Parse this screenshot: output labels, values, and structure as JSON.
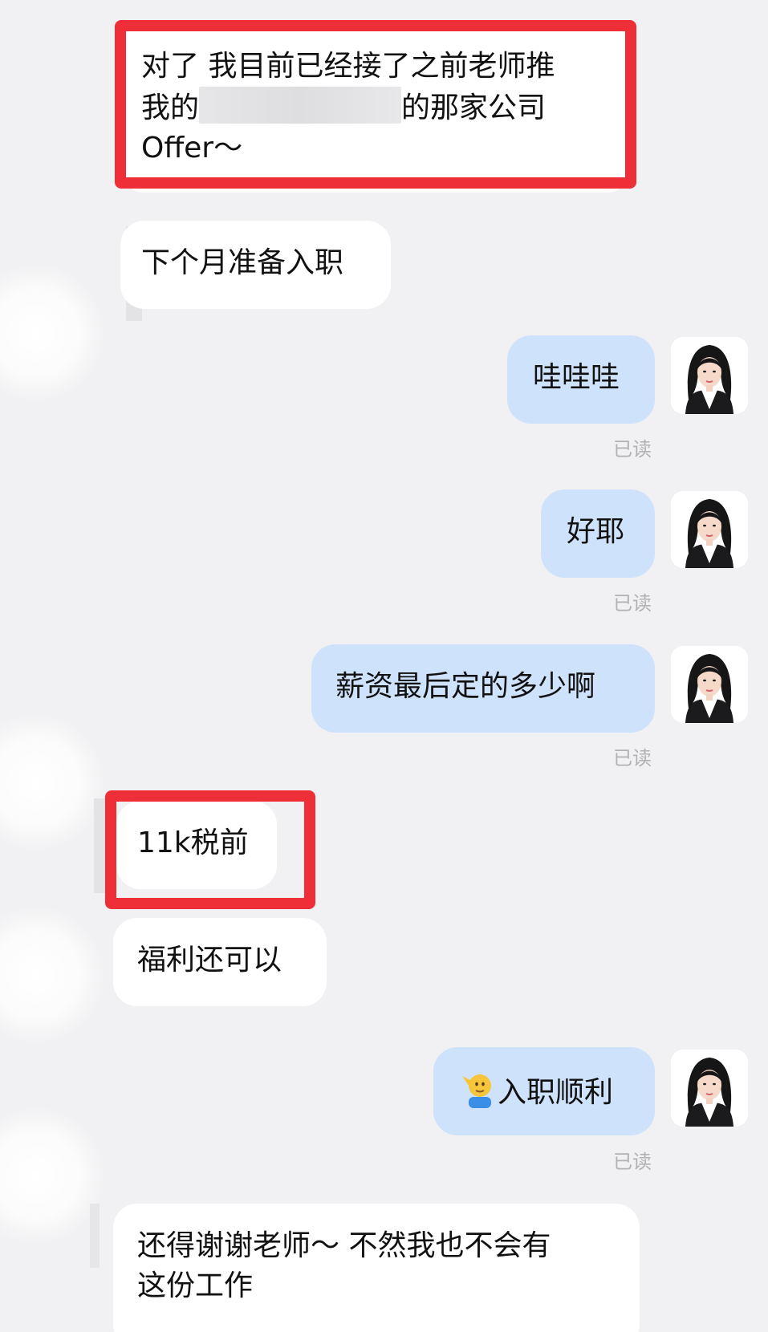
{
  "messages": {
    "m1": {
      "line1": "对了 我目前已经接了之前老师推",
      "line2_prefix": "我的",
      "line2_suffix": "的那家公司",
      "line3": "Offer～"
    },
    "m2": "下个月准备入职",
    "m3": "哇哇哇",
    "m4": "好耶",
    "m5": "薪资最后定的多少啊",
    "m6": "11k税前",
    "m7": "福利还可以",
    "m8": "入职顺利",
    "m9": {
      "line1": "还得谢谢老师～ 不然我也不会有",
      "line2": "这份工作"
    }
  },
  "read_label": "已读",
  "icons": {
    "avatar": "teacher-avatar-photo",
    "emoji": "salute-emoji-icon",
    "redaction": "redacted-company-name"
  },
  "colors": {
    "background": "#f1f1f3",
    "incoming_bubble": "#ffffff",
    "outgoing_bubble": "#cfe2fb",
    "highlight": "#ef2f37",
    "read_text": "#b2b2b6"
  }
}
